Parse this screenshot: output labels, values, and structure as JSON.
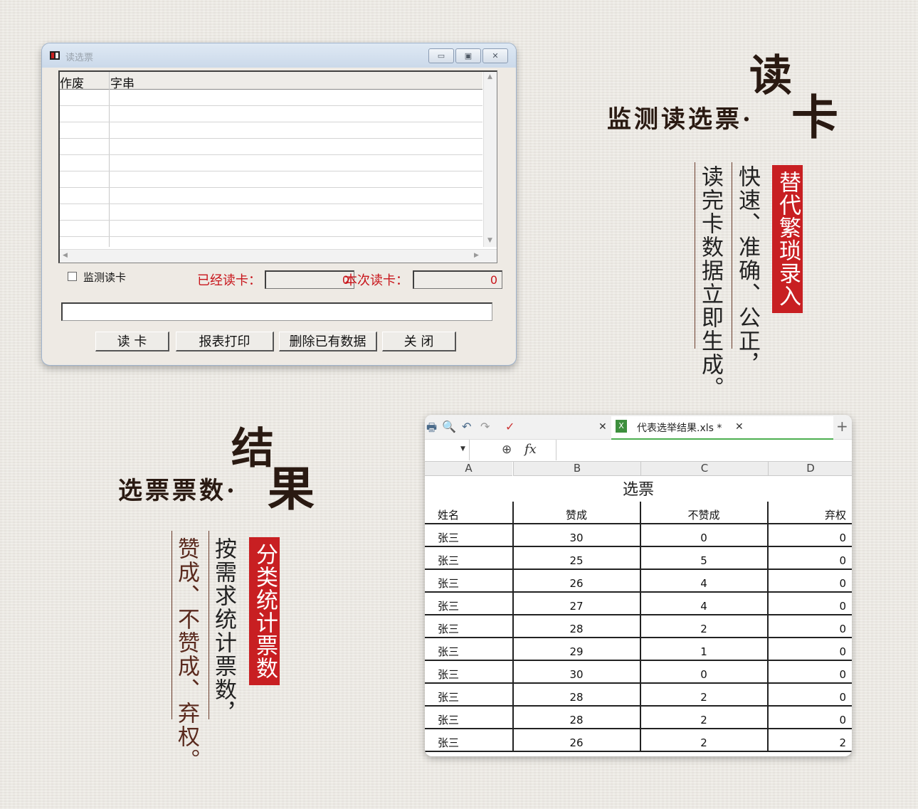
{
  "dialog": {
    "title": "读选票",
    "columns": [
      "作废",
      "字串"
    ],
    "monitor_checkbox_label": "监测读卡",
    "read_count_label": "已经读卡：",
    "read_count_value": "0",
    "this_read_label": "本次读卡：",
    "this_read_value": "0",
    "buttons": {
      "read": "读 卡",
      "print": "报表打印",
      "delete": "删除已有数据",
      "close": "关 闭"
    },
    "window_controls": {
      "minimize": "▭",
      "maximize": "▣",
      "close": "✕"
    }
  },
  "section_read": {
    "subtitle": "监测读选票·",
    "big_top": "读",
    "big_bottom": "卡",
    "red_tag": "替代繁琐录入",
    "line1": "快速、准确、公正，",
    "line2": "读完卡数据立即生成。"
  },
  "section_result": {
    "subtitle": "选票票数·",
    "big_top": "结",
    "big_bottom": "果",
    "red_tag": "分类统计票数",
    "line1": "按需求统计票数，",
    "line2": "赞成、不赞成、弃权。"
  },
  "spreadsheet": {
    "tab_title": "代表选举结果.xls *",
    "fx": "fx",
    "column_letters": [
      "A",
      "B",
      "C",
      "D"
    ],
    "title": "选票",
    "headers": [
      "姓名",
      "赞成",
      "不赞成",
      "弃权"
    ],
    "rows": [
      [
        "张三",
        "30",
        "0",
        "0"
      ],
      [
        "张三",
        "25",
        "5",
        "0"
      ],
      [
        "张三",
        "26",
        "4",
        "0"
      ],
      [
        "张三",
        "27",
        "4",
        "0"
      ],
      [
        "张三",
        "28",
        "2",
        "0"
      ],
      [
        "张三",
        "29",
        "1",
        "0"
      ],
      [
        "张三",
        "30",
        "0",
        "0"
      ],
      [
        "张三",
        "28",
        "2",
        "0"
      ],
      [
        "张三",
        "28",
        "2",
        "0"
      ],
      [
        "张三",
        "26",
        "2",
        "2"
      ]
    ]
  }
}
